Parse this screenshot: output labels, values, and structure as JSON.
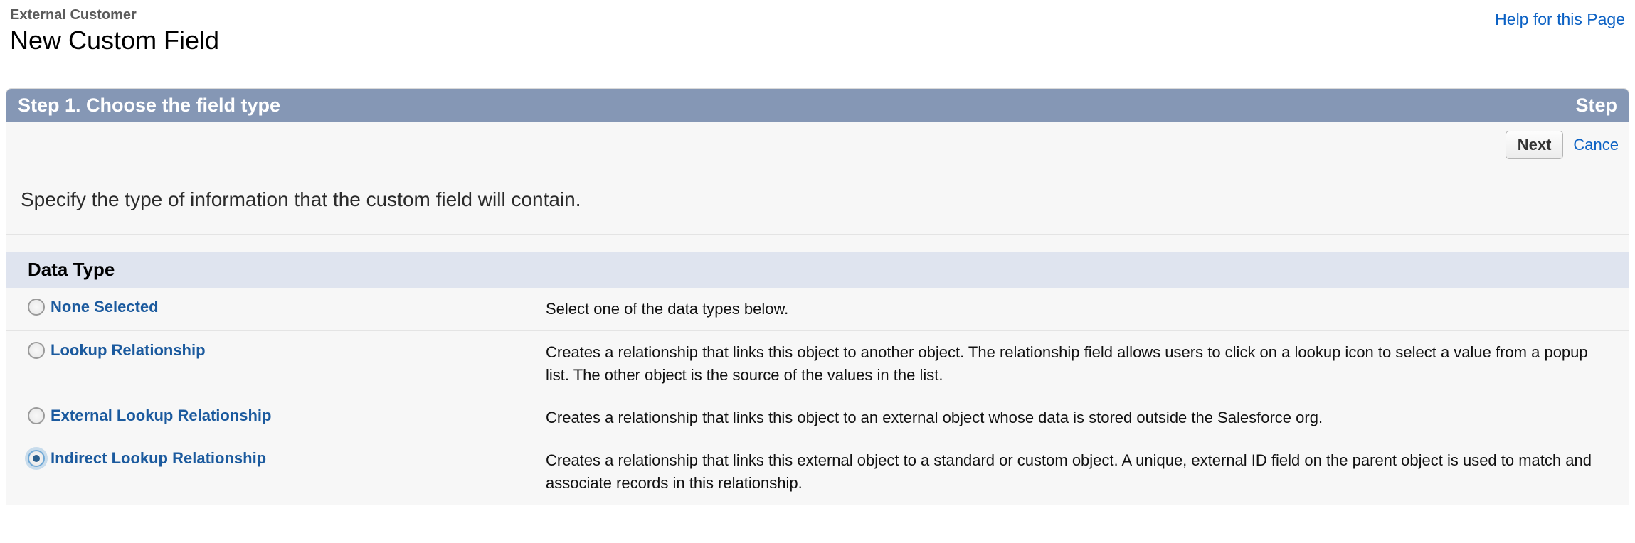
{
  "header": {
    "breadcrumb": "External Customer",
    "title": "New Custom Field",
    "help_link": "Help for this Page"
  },
  "step": {
    "left": "Step 1. Choose the field type",
    "right": "Step",
    "next_btn": "Next",
    "cancel_link": "Cance",
    "instruction": "Specify the type of information that the custom field will contain."
  },
  "section": {
    "title": "Data Type"
  },
  "options": [
    {
      "label": "None Selected",
      "desc": "Select one of the data types below.",
      "selected": false
    },
    {
      "label": "Lookup Relationship",
      "desc": "Creates a relationship that links this object to another object. The relationship field allows users to click on a lookup icon to select a value from a popup list. The other object is the source of the values in the list.",
      "selected": false
    },
    {
      "label": "External Lookup Relationship",
      "desc": "Creates a relationship that links this object to an external object whose data is stored outside the Salesforce org.",
      "selected": false
    },
    {
      "label": "Indirect Lookup Relationship",
      "desc": "Creates a relationship that links this external object to a standard or custom object. A unique, external ID field on the parent object is used to match and associate records in this relationship.",
      "selected": true
    }
  ]
}
